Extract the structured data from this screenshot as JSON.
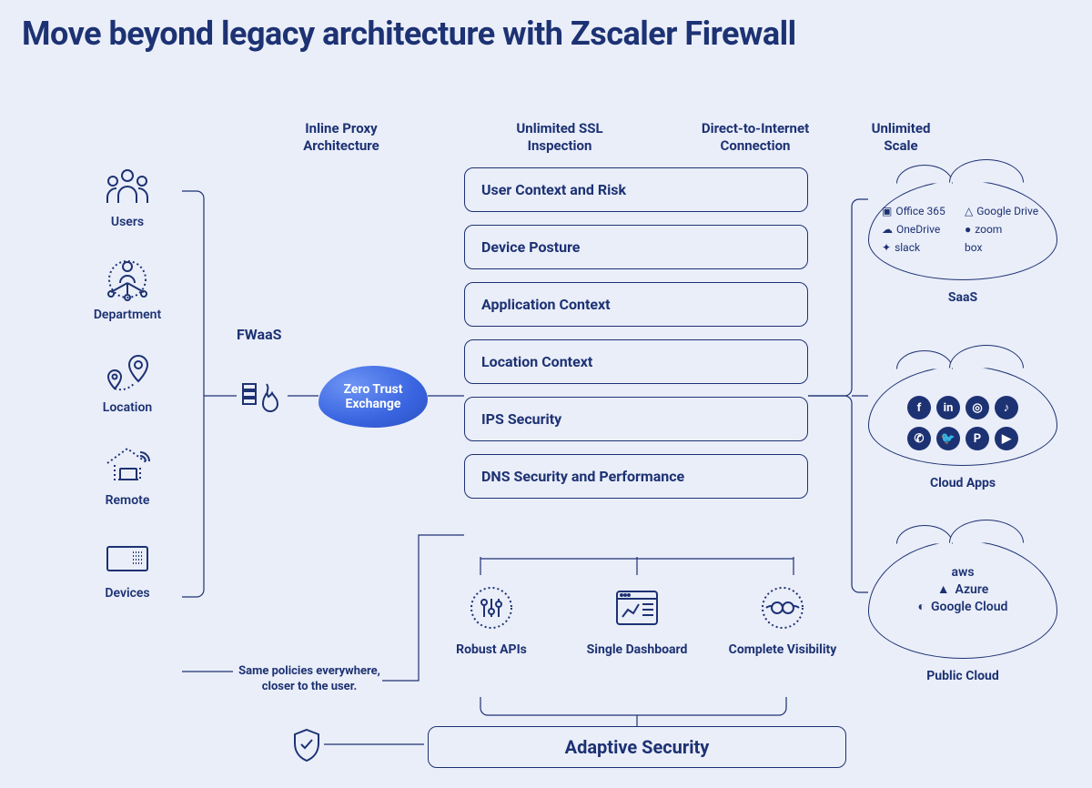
{
  "header": {
    "title": "Move beyond legacy architecture with Zscaler Firewall"
  },
  "top_labels": {
    "col1": "Inline Proxy\nArchitecture",
    "col2": "Unlimited SSL\nInspection",
    "col3": "Direct-to-Internet\nConnection",
    "col4": "Unlimited\nScale"
  },
  "left_items": [
    {
      "label": "Users",
      "icon": "users-icon"
    },
    {
      "label": "Department",
      "icon": "department-icon"
    },
    {
      "label": "Location",
      "icon": "location-icon"
    },
    {
      "label": "Remote",
      "icon": "remote-icon"
    },
    {
      "label": "Devices",
      "icon": "devices-icon"
    }
  ],
  "fwaas": {
    "label": "FWaaS",
    "zte": "Zero Trust\nExchange"
  },
  "center_boxes": [
    "User Context and Risk",
    "Device Posture",
    "Application Context",
    "Location Context",
    "IPS Security",
    "DNS Security and Performance"
  ],
  "trio": [
    {
      "label": "Robust APIs",
      "icon": "api-icon"
    },
    {
      "label": "Single Dashboard",
      "icon": "dashboard-icon"
    },
    {
      "label": "Complete Visibility",
      "icon": "visibility-icon"
    }
  ],
  "adaptive_label": "Adaptive Security",
  "policies_note": "Same policies everywhere, closer to the user.",
  "clouds": {
    "saas": {
      "label": "SaaS",
      "apps": [
        "Office 365",
        "Google Drive",
        "OneDrive",
        "zoom",
        "slack",
        "box"
      ]
    },
    "cloud_apps": {
      "label": "Cloud Apps",
      "icons": [
        "f",
        "in",
        "◎",
        "♪",
        "✆",
        "🐦",
        "P",
        "▶"
      ]
    },
    "public_cloud": {
      "label": "Public Cloud",
      "providers": [
        "aws",
        "Azure",
        "Google Cloud"
      ]
    }
  }
}
